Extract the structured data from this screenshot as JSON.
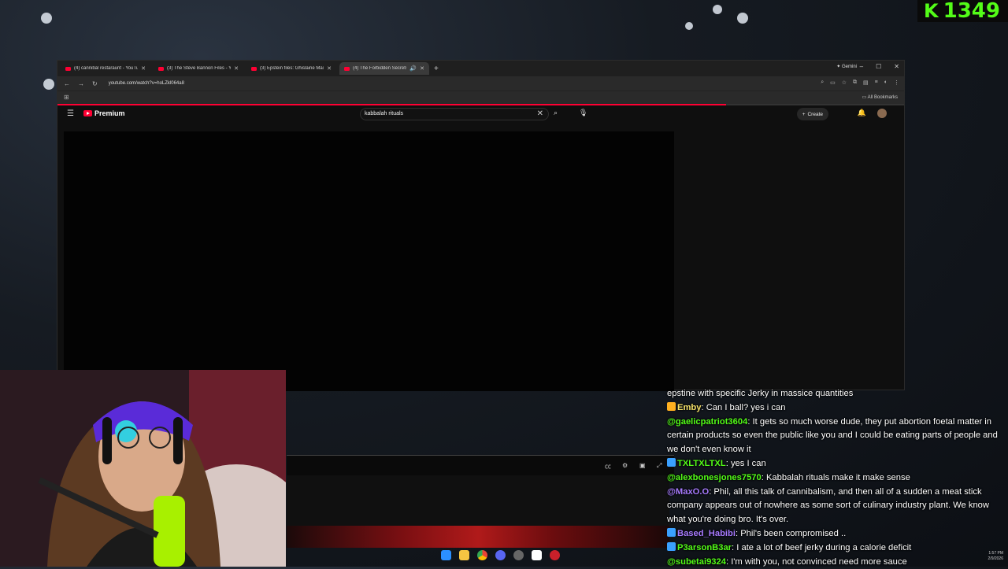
{
  "overlay": {
    "kick_count": "1349",
    "accent": "#53fc18"
  },
  "browser": {
    "tabs": [
      {
        "title": "(4) cannibal restaraunt - YouTub"
      },
      {
        "title": "(3) The Steve Bannon Files - Yo"
      },
      {
        "title": "(3) Epstein files: Ghislaine Max"
      },
      {
        "title": "(4) The Forbidden Secrets O"
      }
    ],
    "gemini_label": "Gemini",
    "url": "youtube.com/watch?v=hoLZkl064a8",
    "all_bookmarks": "All Bookmarks"
  },
  "youtube": {
    "brand": "Premium",
    "search_value": "kabbalah rituals",
    "create_label": "Create",
    "progress_fraction": 0.79
  },
  "chat": {
    "messages": [
      {
        "user": "",
        "text": "epstine with specific Jerky in massice quantities",
        "color": "#ffffff"
      },
      {
        "user": "Emby",
        "text": "Can I ball? yes i can",
        "color": "#f7e36b",
        "badge": "#ffb020"
      },
      {
        "user": "@gaelicpatriot3604",
        "text": "It gets so much worse dude, they put abortion foetal matter in certain products so even the public like you and I could be eating parts of people and we don't even know it",
        "color": "#53fc18"
      },
      {
        "user": "TXLTXLTXL",
        "text": "yes I can",
        "color": "#53fc18",
        "badge": "#3aa0ff"
      },
      {
        "user": "@alexbonesjones7570",
        "text": "Kabbalah rituals make it make sense",
        "color": "#53fc18"
      },
      {
        "user": "@MaxO.O",
        "text": "Phil, all this talk of cannibalism, and then all of a sudden a meat stick company appears out of nowhere as some sort of culinary industry plant. We know what you're doing bro. It's over.",
        "color": "#a77bff"
      },
      {
        "user": "Based_Habibi",
        "text": "Phil's been compromised ..",
        "color": "#a77bff",
        "badge": "#3aa0ff"
      },
      {
        "user": "P3arsonB3ar",
        "text": "I ate a lot of beef jerky during a calorie deficit",
        "color": "#53fc18",
        "badge": "#3aa0ff"
      },
      {
        "user": "@subetai9324",
        "text": "I'm with you, not convinced need more sauce",
        "color": "#53fc18"
      }
    ]
  },
  "taskbar": {
    "time": "1:57 PM",
    "date": "2/9/2026"
  }
}
